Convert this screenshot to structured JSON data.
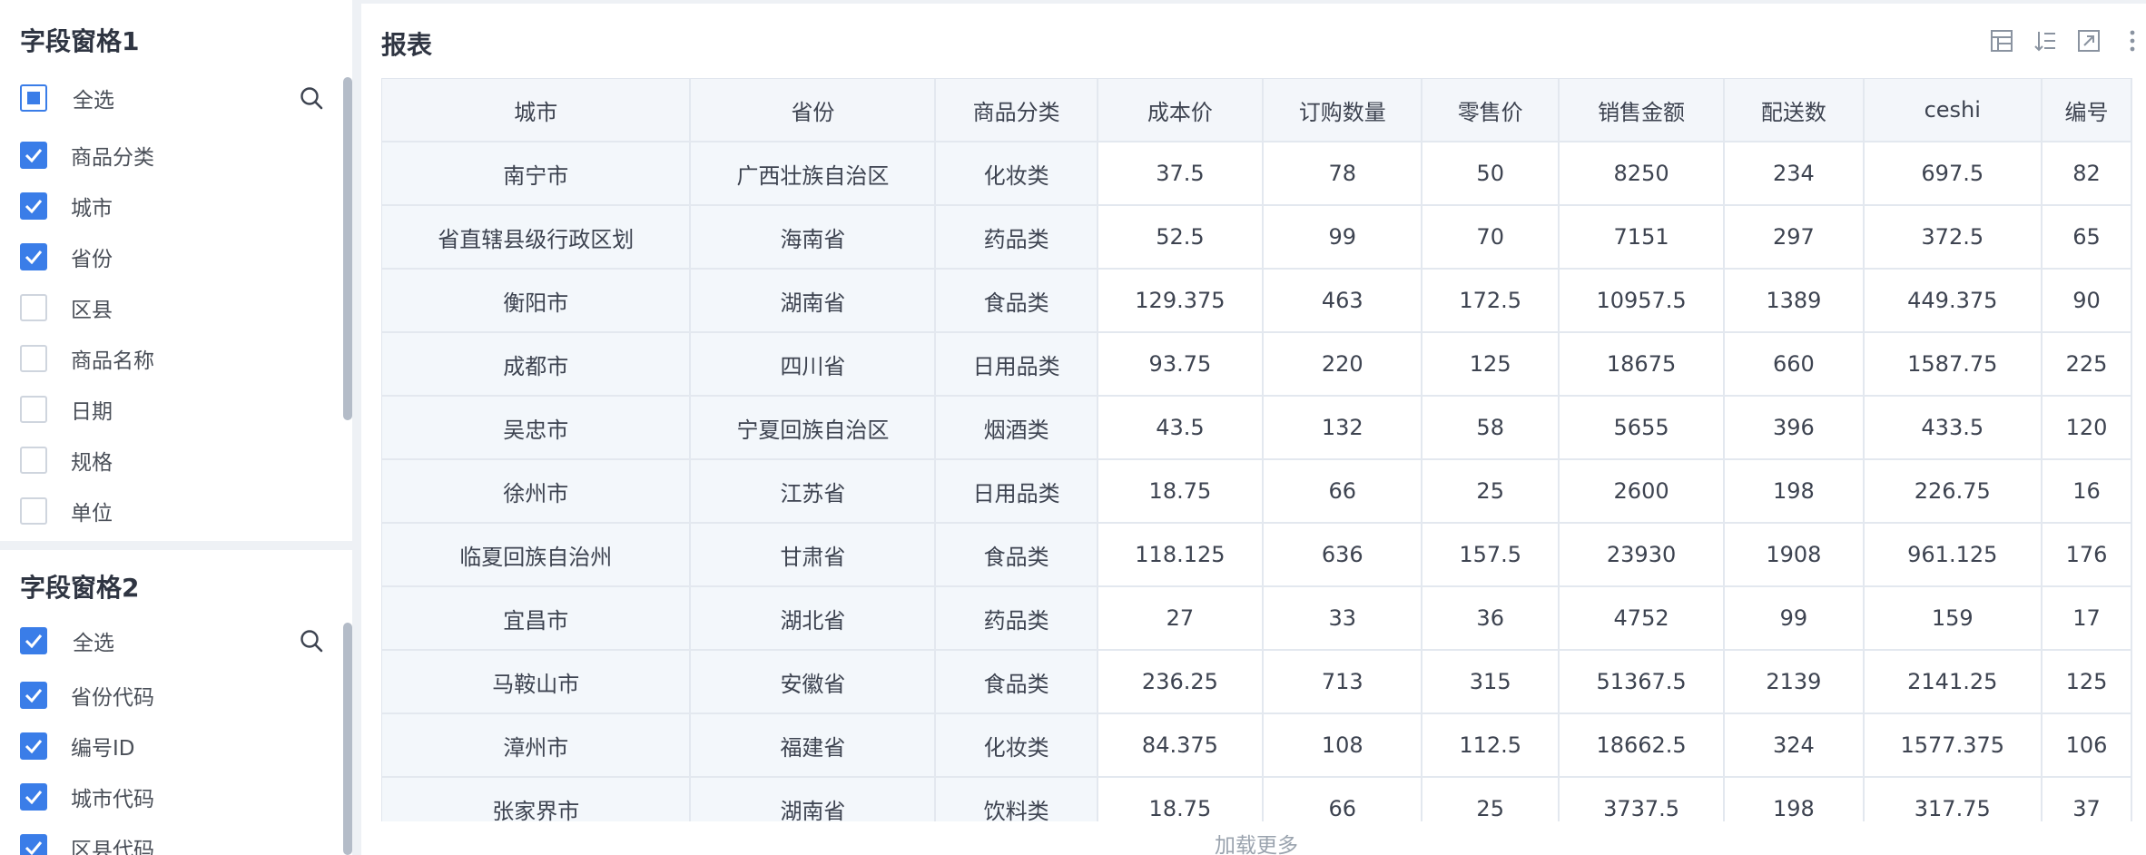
{
  "panel1": {
    "title": "字段窗格1",
    "select_all": "全选",
    "fields": [
      {
        "label": "商品分类",
        "checked": true
      },
      {
        "label": "城市",
        "checked": true
      },
      {
        "label": "省份",
        "checked": true
      },
      {
        "label": "区县",
        "checked": false
      },
      {
        "label": "商品名称",
        "checked": false
      },
      {
        "label": "日期",
        "checked": false
      },
      {
        "label": "规格",
        "checked": false
      },
      {
        "label": "单位",
        "checked": false
      }
    ]
  },
  "panel2": {
    "title": "字段窗格2",
    "select_all": "全选",
    "fields": [
      {
        "label": "省份代码",
        "checked": true
      },
      {
        "label": "编号ID",
        "checked": true
      },
      {
        "label": "城市代码",
        "checked": true
      },
      {
        "label": "区县代码",
        "checked": true
      }
    ]
  },
  "report": {
    "title": "报表",
    "toolbar_icons": [
      "layout-icon",
      "sort-icon",
      "expand-icon",
      "more-icon"
    ],
    "columns": [
      "城市",
      "省份",
      "商品分类",
      "成本价",
      "订购数量",
      "零售价",
      "销售金额",
      "配送数",
      "ceshi",
      "编号"
    ],
    "rows": [
      [
        "南宁市",
        "广西壮族自治区",
        "化妆类",
        "37.5",
        "78",
        "50",
        "8250",
        "234",
        "697.5",
        "82"
      ],
      [
        "省直辖县级行政区划",
        "海南省",
        "药品类",
        "52.5",
        "99",
        "70",
        "7151",
        "297",
        "372.5",
        "65"
      ],
      [
        "衡阳市",
        "湖南省",
        "食品类",
        "129.375",
        "463",
        "172.5",
        "10957.5",
        "1389",
        "449.375",
        "90"
      ],
      [
        "成都市",
        "四川省",
        "日用品类",
        "93.75",
        "220",
        "125",
        "18675",
        "660",
        "1587.75",
        "225"
      ],
      [
        "吴忠市",
        "宁夏回族自治区",
        "烟酒类",
        "43.5",
        "132",
        "58",
        "5655",
        "396",
        "433.5",
        "120"
      ],
      [
        "徐州市",
        "江苏省",
        "日用品类",
        "18.75",
        "66",
        "25",
        "2600",
        "198",
        "226.75",
        "16"
      ],
      [
        "临夏回族自治州",
        "甘肃省",
        "食品类",
        "118.125",
        "636",
        "157.5",
        "23930",
        "1908",
        "961.125",
        "176"
      ],
      [
        "宜昌市",
        "湖北省",
        "药品类",
        "27",
        "33",
        "36",
        "4752",
        "99",
        "159",
        "17"
      ],
      [
        "马鞍山市",
        "安徽省",
        "食品类",
        "236.25",
        "713",
        "315",
        "51367.5",
        "2139",
        "2141.25",
        "125"
      ],
      [
        "漳州市",
        "福建省",
        "化妆类",
        "84.375",
        "108",
        "112.5",
        "18662.5",
        "324",
        "1577.375",
        "106"
      ],
      [
        "张家界市",
        "湖南省",
        "饮料类",
        "18.75",
        "66",
        "25",
        "3737.5",
        "198",
        "317.75",
        "37"
      ]
    ],
    "load_more": "加载更多"
  },
  "colors": {
    "accent": "#3a7de8",
    "dimension_cell_bg": "#f3f7fb",
    "header_bg": "#f3f6fa"
  }
}
